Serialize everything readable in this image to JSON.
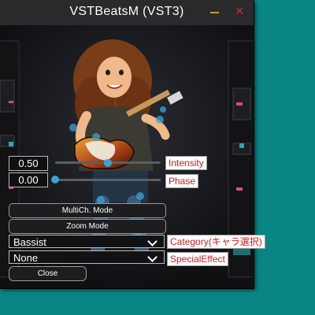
{
  "window": {
    "title": "VSTBeatsM (VST3)",
    "minimize_icon": "minimize-icon",
    "close_icon": "close-icon",
    "close_glyph": "✕"
  },
  "colors": {
    "desktop": "#0a8585",
    "label_text": "#d41e1e",
    "knob": "#3aa3d6"
  },
  "params": [
    {
      "value": "0.50",
      "label": "Intensity",
      "level": 0.5
    },
    {
      "value": "0.00",
      "label": "Phase",
      "level": 0.0
    }
  ],
  "buttons": {
    "multich": "MultiCh. Mode",
    "zoom": "Zoom Mode",
    "close": "Close"
  },
  "category": {
    "value": "Bassist",
    "label": "Category(キャラ選択)"
  },
  "special": {
    "value": "None",
    "label": "SpecialEffect"
  }
}
